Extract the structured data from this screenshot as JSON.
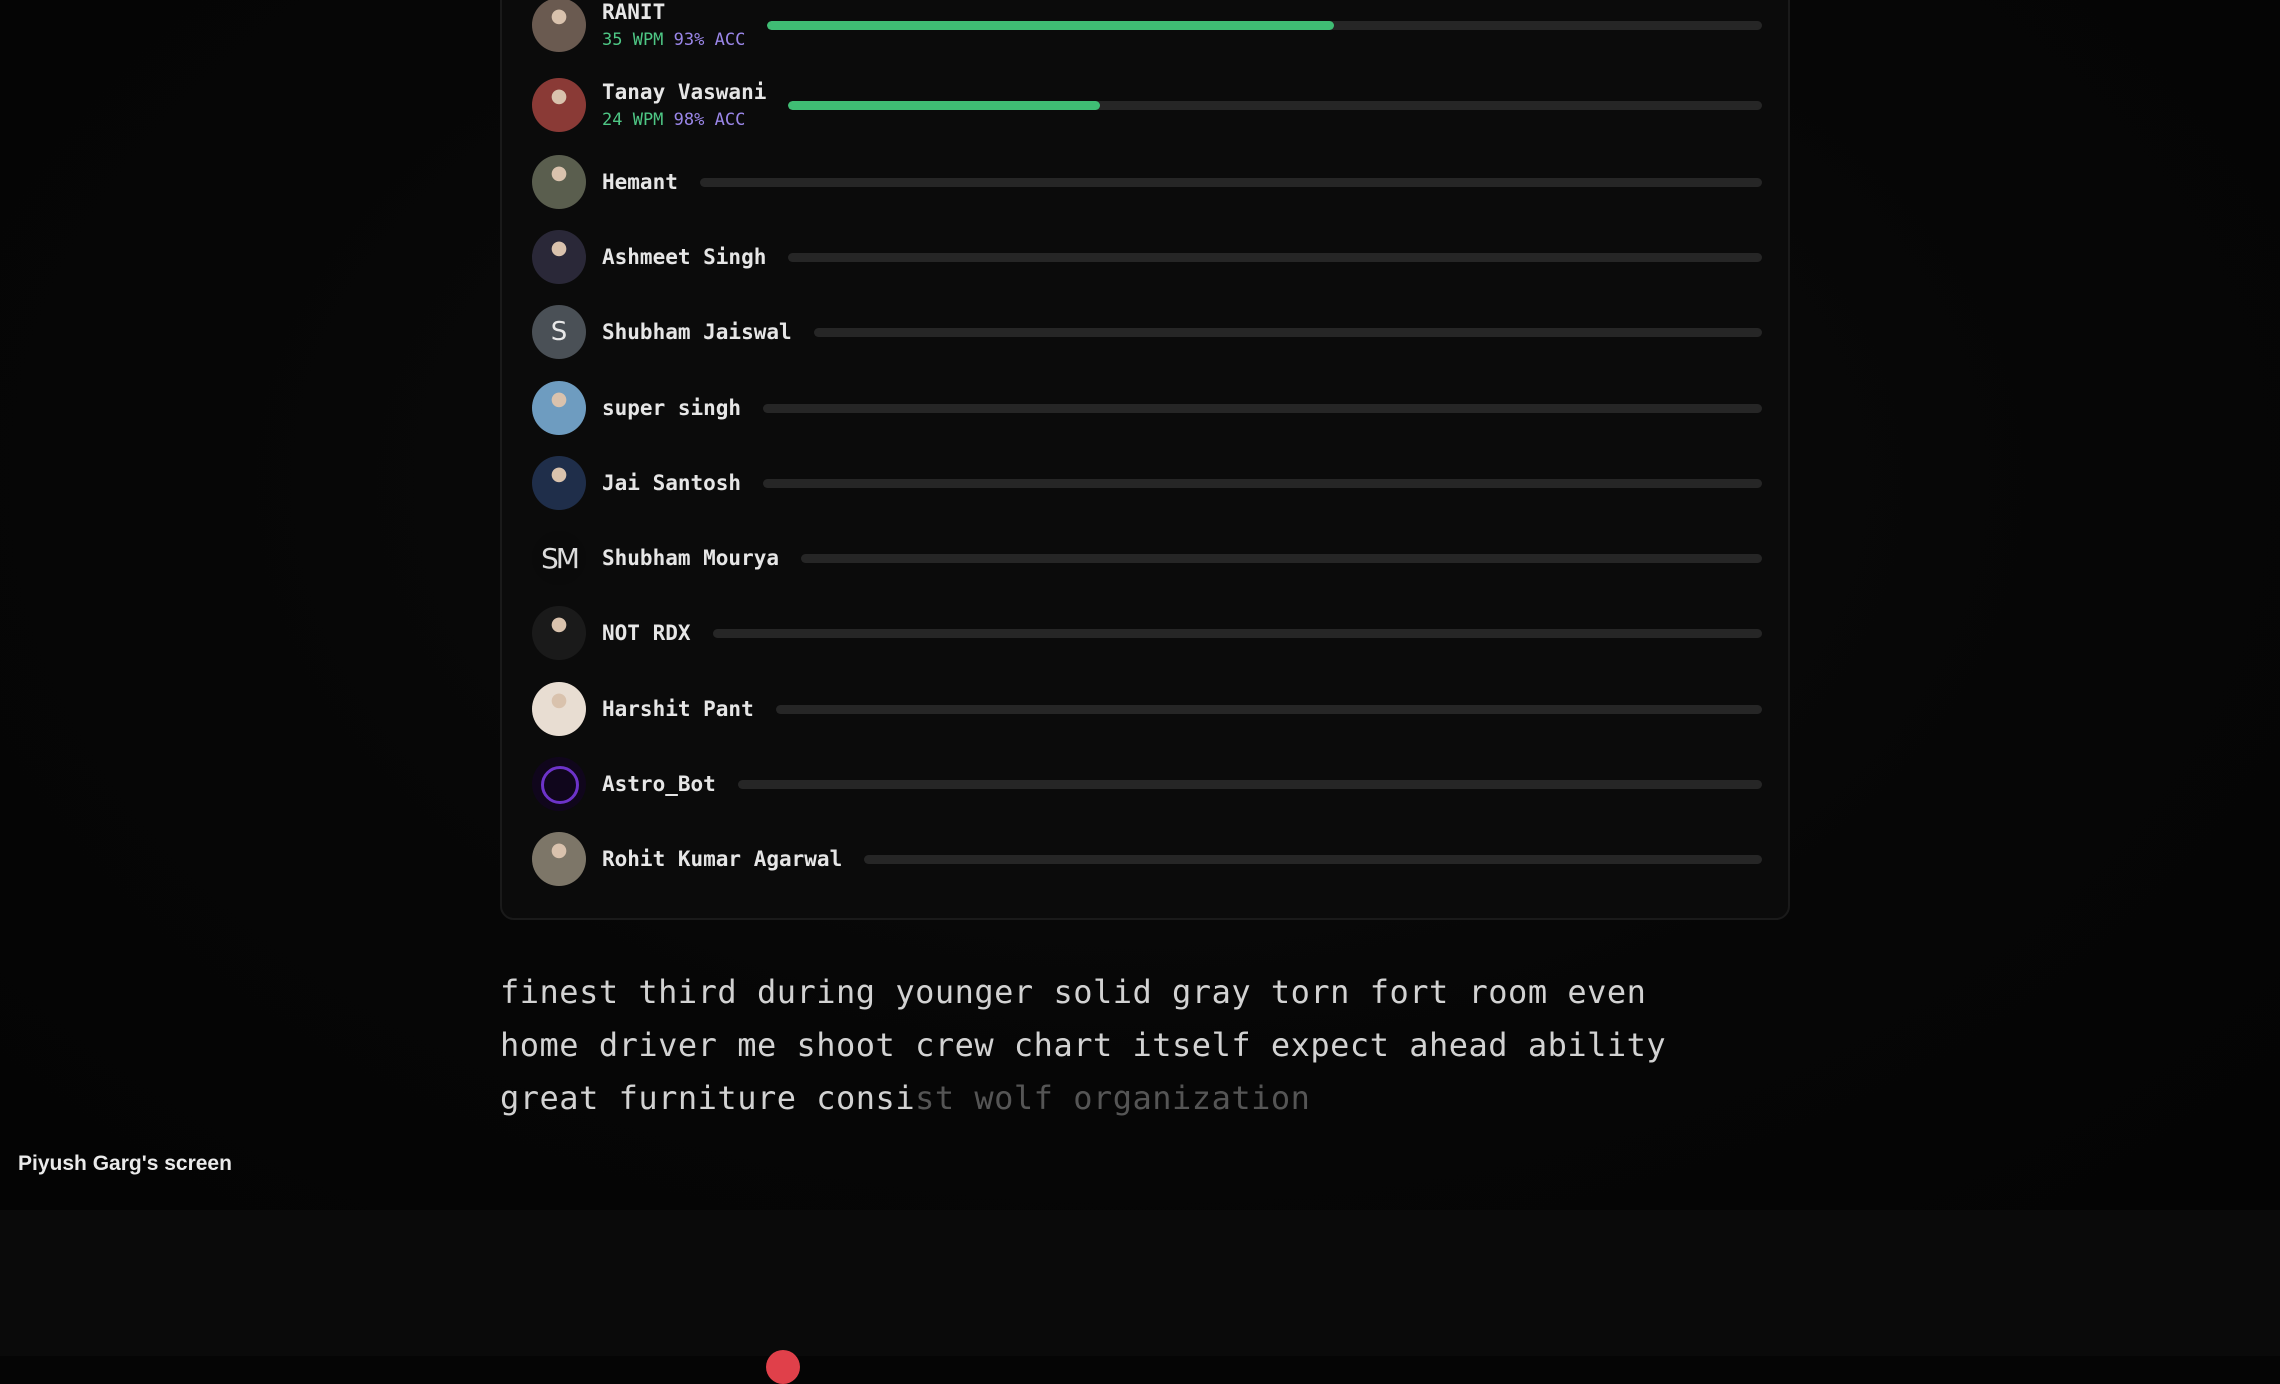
{
  "race": {
    "participants": [
      {
        "name": "RANIT",
        "wpm": "35 WPM",
        "acc": "93% ACC",
        "progress": 0.57,
        "avatar": "photo-person-icon",
        "avatar_color": "#6a5a50"
      },
      {
        "name": "Tanay Vaswani",
        "wpm": "24 WPM",
        "acc": "98% ACC",
        "progress": 0.32,
        "avatar": "photo-person-red-icon",
        "avatar_color": "#8a3a36"
      },
      {
        "name": "Hemant",
        "progress": 0,
        "avatar": "photo-person-glasses-icon",
        "avatar_color": "#5a5e4e"
      },
      {
        "name": "Ashmeet Singh",
        "progress": 0,
        "avatar": "photo-person-sunglasses-icon",
        "avatar_color": "#2a2838"
      },
      {
        "name": "Shubham Jaiswal",
        "progress": 0,
        "avatar": "letter-avatar-icon",
        "letter": "S",
        "avatar_color": "#4a5056"
      },
      {
        "name": "super singh",
        "progress": 0,
        "avatar": "landscape-photo-icon",
        "avatar_color": "#6e9cc0"
      },
      {
        "name": "Jai Santosh",
        "progress": 0,
        "avatar": "night-sky-photo-icon",
        "avatar_color": "#1f2e4a"
      },
      {
        "name": "Shubham Mourya",
        "progress": 0,
        "avatar": "sm-monogram-icon",
        "letter": "SM",
        "avatar_color": "#0a0a0a"
      },
      {
        "name": "NOT RDX",
        "progress": 0,
        "avatar": "skull-icon",
        "avatar_color": "#1a1a1a"
      },
      {
        "name": "Harshit Pant",
        "progress": 0,
        "avatar": "anime-face-icon",
        "avatar_color": "#e8ddd2"
      },
      {
        "name": "Astro_Bot",
        "progress": 0,
        "avatar": "purple-ring-icon",
        "avatar_color": "#10061c"
      },
      {
        "name": "Rohit Kumar Agarwal",
        "progress": 0,
        "avatar": "photo-person-outdoor-icon",
        "avatar_color": "#7d7668"
      }
    ]
  },
  "typing": {
    "line1": "finest third during younger solid gray torn fort room even",
    "line2": "home driver me shoot crew chart itself expect ahead ability",
    "line3_typed": "great furniture consi",
    "line3_pending": "st wolf organization"
  },
  "share": {
    "label": "Piyush Garg's screen"
  },
  "colors": {
    "progress_fill": "#3fbd74",
    "wpm": "#4ec785",
    "acc": "#9a86e8",
    "record": "#e0404a"
  }
}
